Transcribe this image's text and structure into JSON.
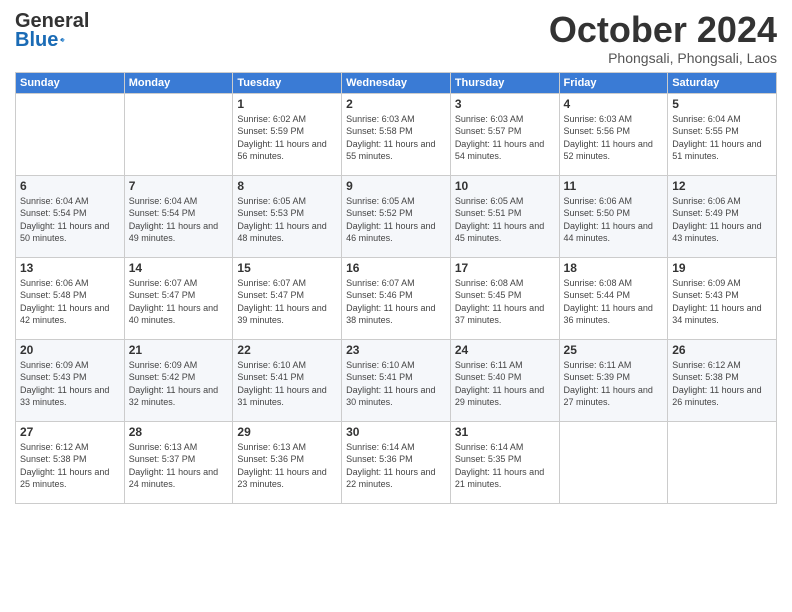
{
  "header": {
    "logo_line1": "General",
    "logo_line2": "Blue",
    "month": "October 2024",
    "location": "Phongsali, Phongsali, Laos"
  },
  "weekdays": [
    "Sunday",
    "Monday",
    "Tuesday",
    "Wednesday",
    "Thursday",
    "Friday",
    "Saturday"
  ],
  "weeks": [
    [
      {
        "day": "",
        "info": ""
      },
      {
        "day": "",
        "info": ""
      },
      {
        "day": "1",
        "info": "Sunrise: 6:02 AM\nSunset: 5:59 PM\nDaylight: 11 hours and 56 minutes."
      },
      {
        "day": "2",
        "info": "Sunrise: 6:03 AM\nSunset: 5:58 PM\nDaylight: 11 hours and 55 minutes."
      },
      {
        "day": "3",
        "info": "Sunrise: 6:03 AM\nSunset: 5:57 PM\nDaylight: 11 hours and 54 minutes."
      },
      {
        "day": "4",
        "info": "Sunrise: 6:03 AM\nSunset: 5:56 PM\nDaylight: 11 hours and 52 minutes."
      },
      {
        "day": "5",
        "info": "Sunrise: 6:04 AM\nSunset: 5:55 PM\nDaylight: 11 hours and 51 minutes."
      }
    ],
    [
      {
        "day": "6",
        "info": "Sunrise: 6:04 AM\nSunset: 5:54 PM\nDaylight: 11 hours and 50 minutes."
      },
      {
        "day": "7",
        "info": "Sunrise: 6:04 AM\nSunset: 5:54 PM\nDaylight: 11 hours and 49 minutes."
      },
      {
        "day": "8",
        "info": "Sunrise: 6:05 AM\nSunset: 5:53 PM\nDaylight: 11 hours and 48 minutes."
      },
      {
        "day": "9",
        "info": "Sunrise: 6:05 AM\nSunset: 5:52 PM\nDaylight: 11 hours and 46 minutes."
      },
      {
        "day": "10",
        "info": "Sunrise: 6:05 AM\nSunset: 5:51 PM\nDaylight: 11 hours and 45 minutes."
      },
      {
        "day": "11",
        "info": "Sunrise: 6:06 AM\nSunset: 5:50 PM\nDaylight: 11 hours and 44 minutes."
      },
      {
        "day": "12",
        "info": "Sunrise: 6:06 AM\nSunset: 5:49 PM\nDaylight: 11 hours and 43 minutes."
      }
    ],
    [
      {
        "day": "13",
        "info": "Sunrise: 6:06 AM\nSunset: 5:48 PM\nDaylight: 11 hours and 42 minutes."
      },
      {
        "day": "14",
        "info": "Sunrise: 6:07 AM\nSunset: 5:47 PM\nDaylight: 11 hours and 40 minutes."
      },
      {
        "day": "15",
        "info": "Sunrise: 6:07 AM\nSunset: 5:47 PM\nDaylight: 11 hours and 39 minutes."
      },
      {
        "day": "16",
        "info": "Sunrise: 6:07 AM\nSunset: 5:46 PM\nDaylight: 11 hours and 38 minutes."
      },
      {
        "day": "17",
        "info": "Sunrise: 6:08 AM\nSunset: 5:45 PM\nDaylight: 11 hours and 37 minutes."
      },
      {
        "day": "18",
        "info": "Sunrise: 6:08 AM\nSunset: 5:44 PM\nDaylight: 11 hours and 36 minutes."
      },
      {
        "day": "19",
        "info": "Sunrise: 6:09 AM\nSunset: 5:43 PM\nDaylight: 11 hours and 34 minutes."
      }
    ],
    [
      {
        "day": "20",
        "info": "Sunrise: 6:09 AM\nSunset: 5:43 PM\nDaylight: 11 hours and 33 minutes."
      },
      {
        "day": "21",
        "info": "Sunrise: 6:09 AM\nSunset: 5:42 PM\nDaylight: 11 hours and 32 minutes."
      },
      {
        "day": "22",
        "info": "Sunrise: 6:10 AM\nSunset: 5:41 PM\nDaylight: 11 hours and 31 minutes."
      },
      {
        "day": "23",
        "info": "Sunrise: 6:10 AM\nSunset: 5:41 PM\nDaylight: 11 hours and 30 minutes."
      },
      {
        "day": "24",
        "info": "Sunrise: 6:11 AM\nSunset: 5:40 PM\nDaylight: 11 hours and 29 minutes."
      },
      {
        "day": "25",
        "info": "Sunrise: 6:11 AM\nSunset: 5:39 PM\nDaylight: 11 hours and 27 minutes."
      },
      {
        "day": "26",
        "info": "Sunrise: 6:12 AM\nSunset: 5:38 PM\nDaylight: 11 hours and 26 minutes."
      }
    ],
    [
      {
        "day": "27",
        "info": "Sunrise: 6:12 AM\nSunset: 5:38 PM\nDaylight: 11 hours and 25 minutes."
      },
      {
        "day": "28",
        "info": "Sunrise: 6:13 AM\nSunset: 5:37 PM\nDaylight: 11 hours and 24 minutes."
      },
      {
        "day": "29",
        "info": "Sunrise: 6:13 AM\nSunset: 5:36 PM\nDaylight: 11 hours and 23 minutes."
      },
      {
        "day": "30",
        "info": "Sunrise: 6:14 AM\nSunset: 5:36 PM\nDaylight: 11 hours and 22 minutes."
      },
      {
        "day": "31",
        "info": "Sunrise: 6:14 AM\nSunset: 5:35 PM\nDaylight: 11 hours and 21 minutes."
      },
      {
        "day": "",
        "info": ""
      },
      {
        "day": "",
        "info": ""
      }
    ]
  ]
}
